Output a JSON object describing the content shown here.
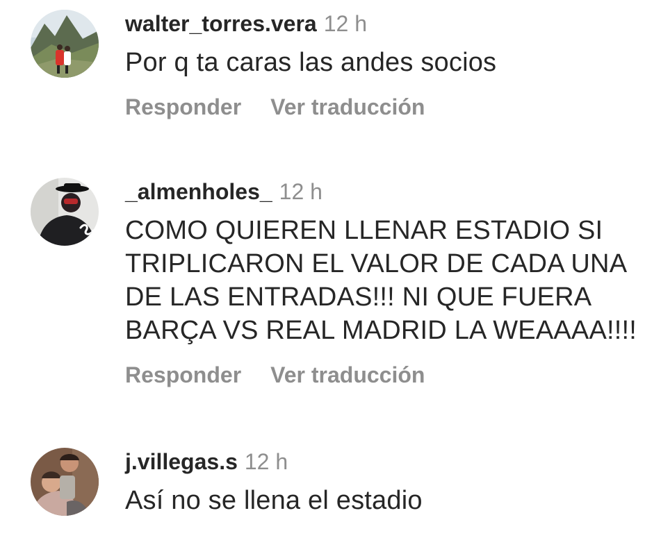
{
  "comments": [
    {
      "username": "walter_torres.vera",
      "time": "12 h",
      "text": "Por q ta caras las andes socios",
      "reply_label": "Responder",
      "translate_label": "Ver traducción"
    },
    {
      "username": "_almenholes_",
      "time": "12 h",
      "text": "COMO QUIEREN LLENAR ESTADIO SI TRIPLICARON EL VALOR DE CADA UNA DE LAS ENTRADAS!!! NI QUE FUERA BARÇA VS REAL MADRID LA WEAAAA!!!!",
      "reply_label": "Responder",
      "translate_label": "Ver traducción"
    },
    {
      "username": "j.villegas.s",
      "time": "12 h",
      "text": "Así no se llena el estadio"
    }
  ],
  "colors": {
    "text_primary": "#262626",
    "text_secondary": "#8e8e8e",
    "background": "#ffffff"
  }
}
